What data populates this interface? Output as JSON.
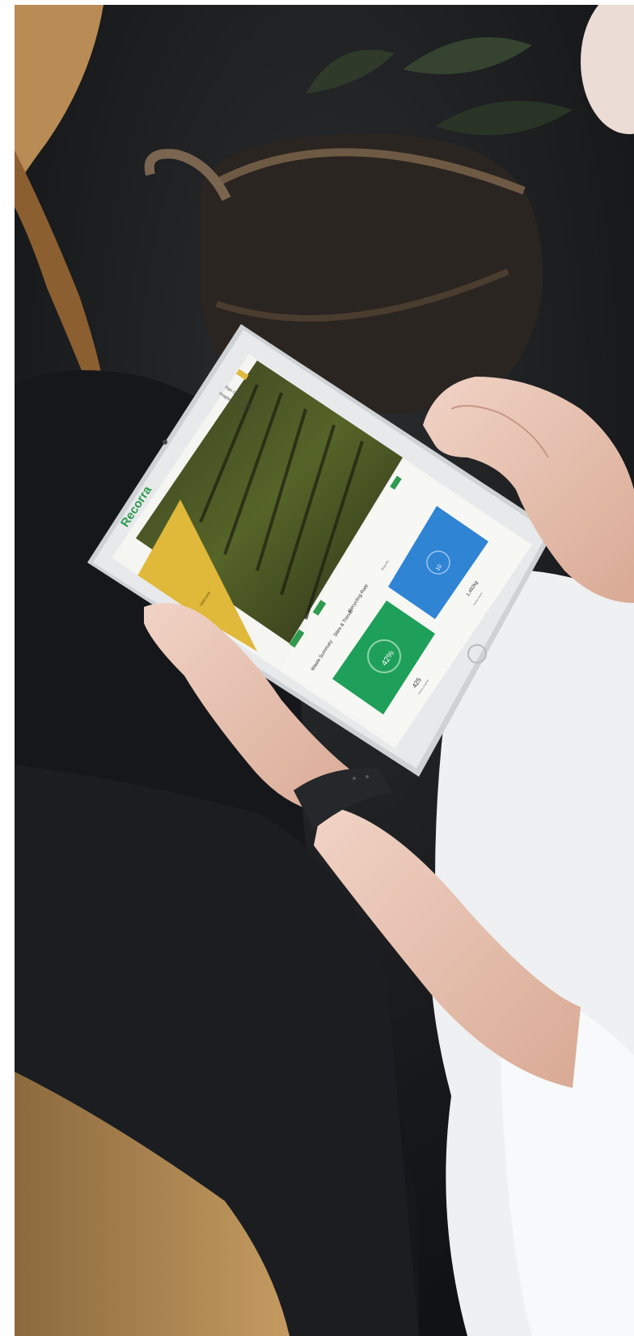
{
  "scene": {
    "description_items": [
      "tablet",
      "hands",
      "smartwatch",
      "plant-basket",
      "chair",
      "trousers",
      "shirt"
    ]
  },
  "screen": {
    "brand": "Recorra",
    "header_link_1": "Sign Out",
    "header_link_2": "Insights Overview",
    "header_link_3": "Sitemap",
    "hero_caption": "Welcome",
    "tab_1": "Waste Summary",
    "tab_2": "Sites & Trends",
    "tab_3": "Recycling Rate",
    "tab_4": "Reports",
    "card_green": {
      "percent": "42%",
      "value": "425",
      "label": "Tonnes recycled",
      "percent_value": 0.42
    },
    "card_blue": {
      "percent": "10",
      "value": "1,482kg",
      "label": "Carbon saved"
    }
  },
  "colors": {
    "brand_green": "#2e9a4e",
    "card_green": "#1fa05a",
    "card_blue": "#2f84d4",
    "hero_yellow": "#e0b83a",
    "watch_band": "#25272a"
  }
}
